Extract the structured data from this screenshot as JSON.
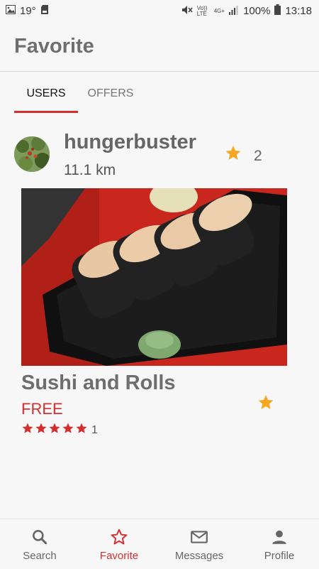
{
  "status_bar": {
    "temperature": "19°",
    "battery": "100%",
    "time": "13:18",
    "volte_label": "Vo)) LTE",
    "network_label": "4G+"
  },
  "app_bar": {
    "title": "Favorite"
  },
  "tabs": [
    {
      "label": "USERS",
      "active": true
    },
    {
      "label": "OFFERS",
      "active": false
    }
  ],
  "user": {
    "name": "hungerbuster",
    "distance": "11.1 km",
    "favorite_count": "2",
    "star_icon": "star-filled-icon"
  },
  "offer": {
    "title": "Sushi and Rolls",
    "price": "FREE",
    "rating": 5,
    "rating_count": "1",
    "favorited": true
  },
  "bottom_nav": [
    {
      "label": "Search",
      "icon": "search-icon",
      "active": false
    },
    {
      "label": "Favorite",
      "icon": "star-outline-icon",
      "active": true
    },
    {
      "label": "Messages",
      "icon": "mail-icon",
      "active": false
    },
    {
      "label": "Profile",
      "icon": "person-icon",
      "active": false
    }
  ],
  "colors": {
    "accent": "#d32f2f",
    "star": "#f5a623",
    "text_gray": "#6e6e6e",
    "background": "#f7f7f7"
  }
}
